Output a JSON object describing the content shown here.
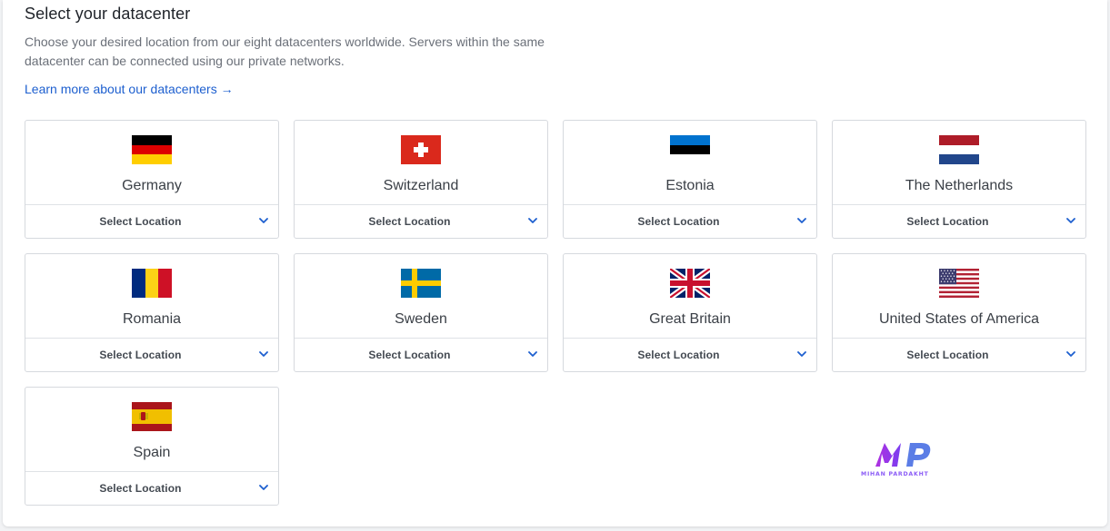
{
  "header": {
    "title": "Select your datacenter",
    "description": "Choose your desired location from our eight datacenters worldwide. Servers within the same datacenter can be connected using our private networks.",
    "learn_more": "Learn more about our datacenters →"
  },
  "datacenters": [
    {
      "country": "Germany",
      "flag": "germany-flag",
      "select_label": "Select Location"
    },
    {
      "country": "Switzerland",
      "flag": "switzerland-flag",
      "select_label": "Select Location"
    },
    {
      "country": "Estonia",
      "flag": "estonia-flag",
      "select_label": "Select Location"
    },
    {
      "country": "The Netherlands",
      "flag": "netherlands-flag",
      "select_label": "Select Location"
    },
    {
      "country": "Romania",
      "flag": "romania-flag",
      "select_label": "Select Location"
    },
    {
      "country": "Sweden",
      "flag": "sweden-flag",
      "select_label": "Select Location"
    },
    {
      "country": "Great Britain",
      "flag": "great-britain-flag",
      "select_label": "Select Location"
    },
    {
      "country": "United States of America",
      "flag": "usa-flag",
      "select_label": "Select Location"
    },
    {
      "country": "Spain",
      "flag": "spain-flag",
      "select_label": "Select Location"
    }
  ],
  "watermark": {
    "logo": "mihan-pardakht-logo",
    "text": "MIHAN PARDAKHT"
  },
  "colors": {
    "link": "#1d5fcf",
    "chevron": "#1d5fcf",
    "card_border": "#d6d9de"
  }
}
